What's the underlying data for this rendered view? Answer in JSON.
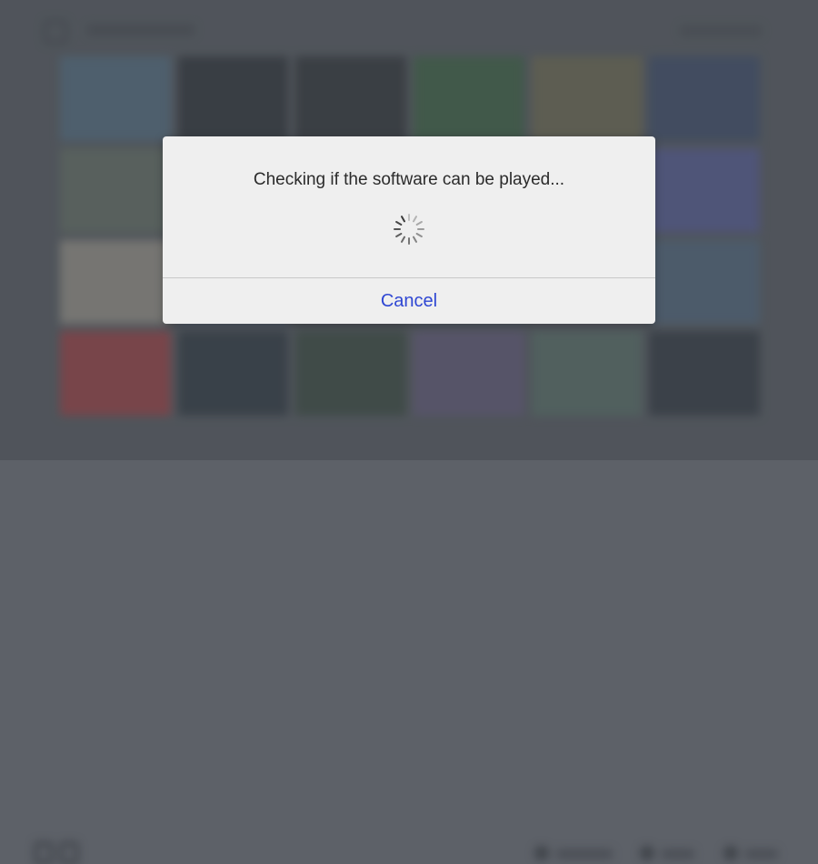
{
  "dialog": {
    "message": "Checking if the software can be played...",
    "cancel_label": "Cancel",
    "accent_color": "#2f47d3"
  },
  "icons": {
    "spinner": "loading-spinner-icon",
    "home": "home-icon",
    "controller": "joycon-icon"
  },
  "background": {
    "tile_colors": [
      "#5a7890",
      "#2b2f36",
      "#2e3136",
      "#3d6a43",
      "#7a7454",
      "#3e4f73",
      "#6f7b6e",
      "#5b6f91",
      "#4f5460",
      "#6aa07a",
      "#8b7a66",
      "#5c62a8",
      "#b1a99c",
      "#5a6d8f",
      "#4a4d55",
      "#5a6a7a",
      "#6f667a",
      "#566f8a",
      "#b63f44",
      "#2c3640",
      "#3a4c3f",
      "#6c5f86",
      "#5f7a70",
      "#2f3640"
    ]
  }
}
